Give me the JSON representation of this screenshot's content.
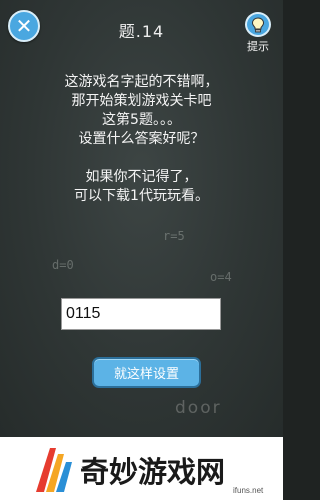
{
  "header": {
    "close_icon": "close-icon",
    "level_title": "题.14",
    "hint_icon": "lightbulb-icon",
    "hint_label": "提示"
  },
  "question": {
    "lines_1": [
      "这游戏名字起的不错啊，",
      "那开始策划游戏关卡吧",
      "这第5题。。。",
      "设置什么答案好呢？"
    ],
    "lines_2": [
      "如果你不记得了，",
      "可以下载1代玩玩看。"
    ]
  },
  "chalk_marks": {
    "r": "r=5",
    "d": "d=0",
    "o": "o=4",
    "door": "door"
  },
  "answer": {
    "value": "0115"
  },
  "submit": {
    "label": "就这样设置"
  },
  "footer": {
    "brand": "奇妙游戏网",
    "domain": "ifuns.net"
  },
  "colors": {
    "board": "#2f3635",
    "button_blue": "#5cb3e6",
    "icon_blue": "#4aa7e0"
  }
}
